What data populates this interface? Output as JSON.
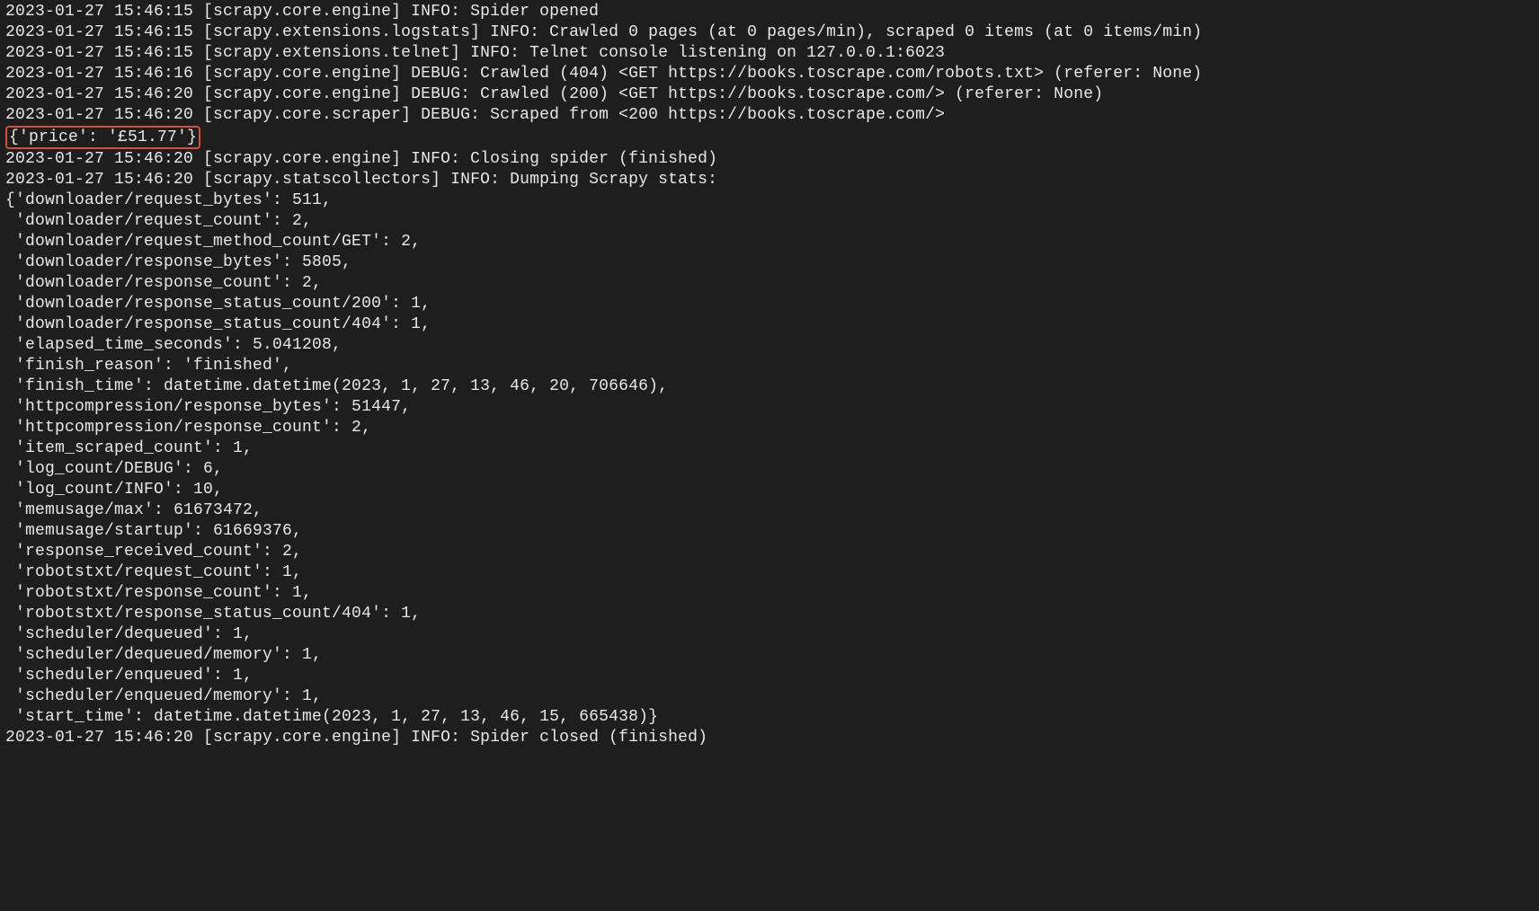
{
  "highlight": "{'price': '£51.77'}",
  "lines": [
    "2023-01-27 15:46:15 [scrapy.core.engine] INFO: Spider opened",
    "2023-01-27 15:46:15 [scrapy.extensions.logstats] INFO: Crawled 0 pages (at 0 pages/min), scraped 0 items (at 0 items/min)",
    "2023-01-27 15:46:15 [scrapy.extensions.telnet] INFO: Telnet console listening on 127.0.0.1:6023",
    "2023-01-27 15:46:16 [scrapy.core.engine] DEBUG: Crawled (404) <GET https://books.toscrape.com/robots.txt> (referer: None)",
    "2023-01-27 15:46:20 [scrapy.core.engine] DEBUG: Crawled (200) <GET https://books.toscrape.com/> (referer: None)",
    "2023-01-27 15:46:20 [scrapy.core.scraper] DEBUG: Scraped from <200 https://books.toscrape.com/>",
    "__HL__",
    "2023-01-27 15:46:20 [scrapy.core.engine] INFO: Closing spider (finished)",
    "2023-01-27 15:46:20 [scrapy.statscollectors] INFO: Dumping Scrapy stats:",
    "{'downloader/request_bytes': 511,",
    " 'downloader/request_count': 2,",
    " 'downloader/request_method_count/GET': 2,",
    " 'downloader/response_bytes': 5805,",
    " 'downloader/response_count': 2,",
    " 'downloader/response_status_count/200': 1,",
    " 'downloader/response_status_count/404': 1,",
    " 'elapsed_time_seconds': 5.041208,",
    " 'finish_reason': 'finished',",
    " 'finish_time': datetime.datetime(2023, 1, 27, 13, 46, 20, 706646),",
    " 'httpcompression/response_bytes': 51447,",
    " 'httpcompression/response_count': 2,",
    " 'item_scraped_count': 1,",
    " 'log_count/DEBUG': 6,",
    " 'log_count/INFO': 10,",
    " 'memusage/max': 61673472,",
    " 'memusage/startup': 61669376,",
    " 'response_received_count': 2,",
    " 'robotstxt/request_count': 1,",
    " 'robotstxt/response_count': 1,",
    " 'robotstxt/response_status_count/404': 1,",
    " 'scheduler/dequeued': 1,",
    " 'scheduler/dequeued/memory': 1,",
    " 'scheduler/enqueued': 1,",
    " 'scheduler/enqueued/memory': 1,",
    " 'start_time': datetime.datetime(2023, 1, 27, 13, 46, 15, 665438)}",
    "2023-01-27 15:46:20 [scrapy.core.engine] INFO: Spider closed (finished)"
  ]
}
